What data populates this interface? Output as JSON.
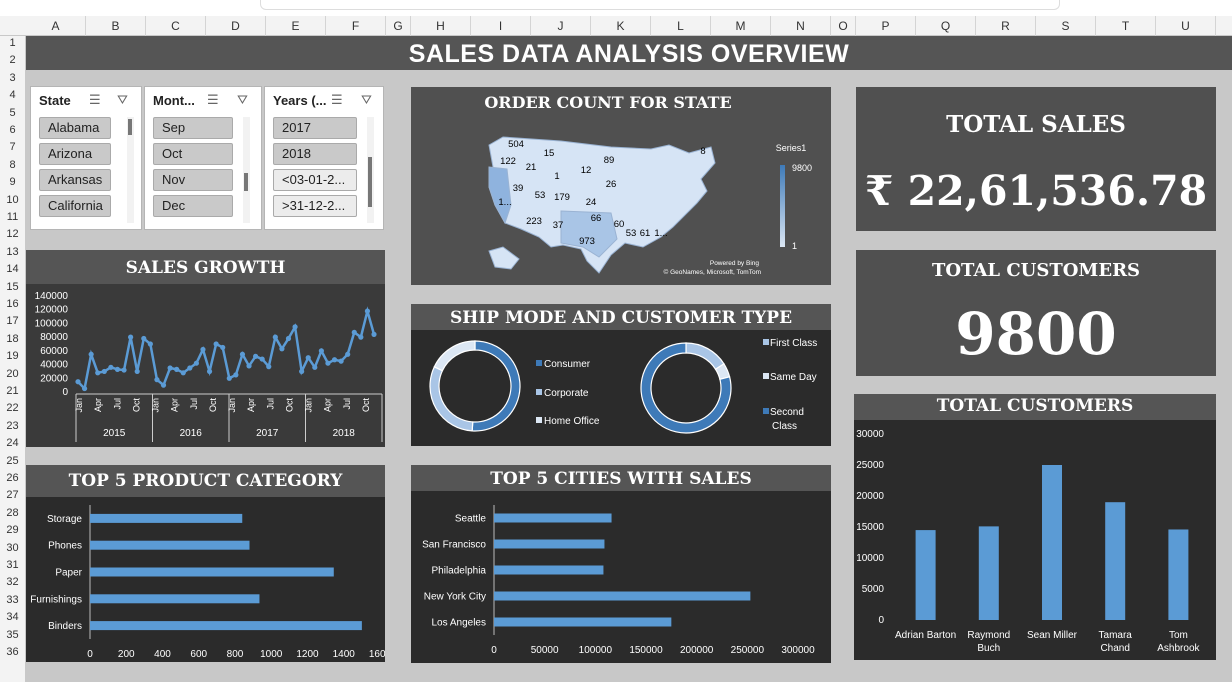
{
  "sheet": {
    "columns": [
      "A",
      "B",
      "C",
      "D",
      "E",
      "F",
      "G",
      "H",
      "I",
      "J",
      "K",
      "L",
      "M",
      "N",
      "O",
      "P",
      "Q",
      "R",
      "S",
      "T",
      "U"
    ],
    "rows": [
      "1",
      "2",
      "3",
      "4",
      "5",
      "6",
      "7",
      "8",
      "9",
      "10",
      "11",
      "12",
      "13",
      "14",
      "15",
      "16",
      "17",
      "18",
      "19",
      "20",
      "21",
      "22",
      "23",
      "24",
      "25",
      "26",
      "27",
      "28",
      "29",
      "30",
      "31",
      "32",
      "33",
      "34",
      "35",
      "36"
    ]
  },
  "dashboard": {
    "title": "SALES DATA ANALYSIS OVERVIEW"
  },
  "slicers": {
    "state": {
      "header": "State",
      "items": [
        "Alabama",
        "Arizona",
        "Arkansas",
        "California"
      ]
    },
    "month": {
      "header": "Mont...",
      "items": [
        "Sep",
        "Oct",
        "Nov",
        "Dec"
      ]
    },
    "years": {
      "header": "Years (...",
      "items": [
        "2017",
        "2018",
        "<03-01-2...",
        ">31-12-2..."
      ]
    }
  },
  "map_panel": {
    "title": "ORDER COUNT FOR STATE",
    "legend_title": "Series1",
    "legend_max": "9800",
    "legend_min": "1",
    "credit1": "Powered by Bing",
    "credit2": "© GeoNames, Microsoft, TomTom",
    "labels": [
      "504",
      "15",
      "122",
      "21",
      "1",
      "12",
      "89",
      "8",
      "39",
      "53",
      "179",
      "24",
      "26",
      "1...",
      "223",
      "37",
      "66",
      "60",
      "973",
      "53",
      "61",
      "1..."
    ]
  },
  "kpis": {
    "total_sales_label": "TOTAL SALES",
    "total_sales_value": "₹ 22,61,536.78",
    "total_customers_label": "TOTAL CUSTOMERS",
    "total_customers_value": "9800"
  },
  "colors": {
    "accent": "#5b9bd5",
    "panel": "#3a3a3a",
    "panel_header": "#555555",
    "dark": "#2b2b2b"
  },
  "chart_data": [
    {
      "id": "sales-growth",
      "type": "line",
      "title": "SALES GROWTH",
      "yticks": [
        "140000",
        "120000",
        "100000",
        "80000",
        "60000",
        "40000",
        "20000",
        "0"
      ],
      "ylim": [
        0,
        140000
      ],
      "years": [
        "2015",
        "2016",
        "2017",
        "2018"
      ],
      "months": [
        "Jan",
        "Apr",
        "Jul",
        "Oct"
      ],
      "values": [
        15000,
        5000,
        55000,
        28000,
        30000,
        36000,
        33000,
        32000,
        80000,
        30000,
        78000,
        70000,
        18000,
        10000,
        35000,
        33000,
        28000,
        35000,
        42000,
        62000,
        30000,
        70000,
        65000,
        20000,
        25000,
        55000,
        38000,
        52000,
        48000,
        37000,
        80000,
        63000,
        78000,
        95000,
        30000,
        50000,
        36000,
        60000,
        42000,
        47000,
        45000,
        55000,
        87000,
        80000,
        118000,
        84000
      ]
    },
    {
      "id": "ship-mode-customer-type",
      "type": "pie",
      "title": "SHIP MODE AND CUSTOMER TYPE",
      "donuts": [
        {
          "categories": [
            "Consumer",
            "Corporate",
            "Home Office"
          ],
          "values": [
            51,
            31,
            18
          ],
          "colors": [
            "#3e7ab8",
            "#a9c5e6",
            "#dce7f4"
          ]
        },
        {
          "categories": [
            "First Class",
            "Same Day",
            "Second Class"
          ],
          "values": [
            16,
            5,
            79
          ],
          "colors": [
            "#a9c5e6",
            "#dce7f4",
            "#3e7ab8"
          ]
        }
      ],
      "legend_left": [
        "Consumer",
        "Corporate",
        "Home Office"
      ],
      "legend_right": [
        "First Class",
        "Same Day",
        "Second",
        "Class"
      ]
    },
    {
      "id": "top-5-product-category",
      "type": "bar",
      "title": "TOP 5 PRODUCT CATEGORY",
      "categories": [
        "Storage",
        "Phones",
        "Paper",
        "Furnishings",
        "Binders"
      ],
      "values": [
        840,
        880,
        1345,
        935,
        1500
      ],
      "xlim": [
        0,
        1600
      ],
      "xticks": [
        "0",
        "200",
        "400",
        "600",
        "800",
        "1000",
        "1200",
        "1400",
        "1600"
      ]
    },
    {
      "id": "top-5-cities-with-sales",
      "type": "bar",
      "title": "TOP 5 CITIES  WITH SALES",
      "categories": [
        "Seattle",
        "San Francisco",
        "Philadelphia",
        "New York City",
        "Los Angeles"
      ],
      "values": [
        116000,
        109000,
        108000,
        253000,
        175000
      ],
      "xlim": [
        0,
        300000
      ],
      "xticks": [
        "0",
        "50000",
        "100000",
        "150000",
        "200000",
        "250000",
        "300000"
      ]
    },
    {
      "id": "total-customers-bar",
      "type": "bar",
      "title": "TOTAL CUSTOMERS",
      "categories": [
        "Adrian Barton",
        "Raymond Buch",
        "Sean Miller",
        "Tamara Chand",
        "Tom Ashbrook"
      ],
      "labels": [
        [
          "Adrian Barton"
        ],
        [
          "Raymond",
          "Buch"
        ],
        [
          "Sean Miller"
        ],
        [
          "Tamara",
          "Chand"
        ],
        [
          "Tom",
          "Ashbrook"
        ]
      ],
      "values": [
        14500,
        15100,
        25000,
        19000,
        14600
      ],
      "ylim": [
        0,
        30000
      ],
      "yticks": [
        "30000",
        "25000",
        "20000",
        "15000",
        "10000",
        "5000",
        "0"
      ]
    }
  ]
}
